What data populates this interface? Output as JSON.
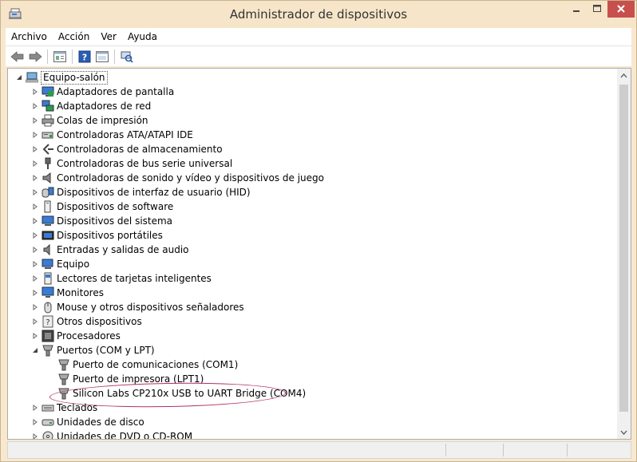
{
  "window": {
    "title": "Administrador de dispositivos",
    "app_icon": "device-manager-icon"
  },
  "menu": {
    "items": [
      "Archivo",
      "Acción",
      "Ver",
      "Ayuda"
    ]
  },
  "toolbar": {
    "buttons": [
      "back-arrow-icon",
      "forward-arrow-icon",
      "properties-icon",
      "help-icon",
      "view-icon",
      "scan-hardware-icon"
    ]
  },
  "tree": {
    "root": "Equipo-salón",
    "categories": [
      {
        "label": "Adaptadores de pantalla",
        "icon": "display-adapter-icon",
        "expanded": false
      },
      {
        "label": "Adaptadores de red",
        "icon": "network-adapter-icon",
        "expanded": false
      },
      {
        "label": "Colas de impresión",
        "icon": "printer-icon",
        "expanded": false
      },
      {
        "label": "Controladoras ATA/ATAPI IDE",
        "icon": "ide-controller-icon",
        "expanded": false
      },
      {
        "label": "Controladoras de almacenamiento",
        "icon": "storage-controller-icon",
        "expanded": false
      },
      {
        "label": "Controladoras de bus serie universal",
        "icon": "usb-icon",
        "expanded": false
      },
      {
        "label": "Controladoras de sonido y vídeo y dispositivos de juego",
        "icon": "speaker-icon",
        "expanded": false
      },
      {
        "label": "Dispositivos de interfaz de usuario (HID)",
        "icon": "hid-icon",
        "expanded": false
      },
      {
        "label": "Dispositivos de software",
        "icon": "software-device-icon",
        "expanded": false
      },
      {
        "label": "Dispositivos del sistema",
        "icon": "system-device-icon",
        "expanded": false
      },
      {
        "label": "Dispositivos portátiles",
        "icon": "portable-device-icon",
        "expanded": false
      },
      {
        "label": "Entradas y salidas de audio",
        "icon": "audio-io-icon",
        "expanded": false
      },
      {
        "label": "Equipo",
        "icon": "computer-icon",
        "expanded": false
      },
      {
        "label": "Lectores de tarjetas inteligentes",
        "icon": "smart-card-icon",
        "expanded": false
      },
      {
        "label": "Monitores",
        "icon": "monitor-icon",
        "expanded": false
      },
      {
        "label": "Mouse y otros dispositivos señaladores",
        "icon": "mouse-icon",
        "expanded": false
      },
      {
        "label": "Otros dispositivos",
        "icon": "unknown-device-icon",
        "expanded": false
      },
      {
        "label": "Procesadores",
        "icon": "processor-icon",
        "expanded": false
      },
      {
        "label": "Puertos (COM y LPT)",
        "icon": "port-icon",
        "expanded": true
      },
      {
        "label": "Teclados",
        "icon": "keyboard-icon",
        "expanded": false
      },
      {
        "label": "Unidades de disco",
        "icon": "disk-drive-icon",
        "expanded": false
      },
      {
        "label": "Unidades de DVD o CD-ROM",
        "icon": "dvd-drive-icon",
        "expanded": false
      }
    ],
    "ports_children": [
      "Puerto de comunicaciones (COM1)",
      "Puerto de impresora (LPT1)",
      "Silicon Labs CP210x USB to UART Bridge (COM4)"
    ],
    "highlighted_child": "Silicon Labs CP210x USB to UART Bridge (COM4)"
  },
  "colors": {
    "frame": "#f8e8cf",
    "close_button": "#c7504c",
    "annotation": "#b0306a"
  }
}
